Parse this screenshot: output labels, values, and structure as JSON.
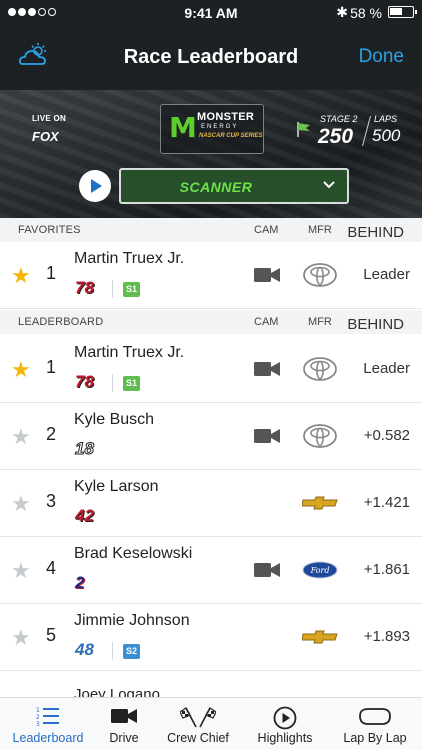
{
  "status": {
    "time": "9:41 AM",
    "battery": "58 %"
  },
  "nav": {
    "title": "Race Leaderboard",
    "done": "Done"
  },
  "hero": {
    "live_label": "LIVE ON",
    "network": "FOX",
    "logo_brand": "MONSTER",
    "logo_sub": "ENERGY",
    "logo_series": "NASCAR CUP SERIES",
    "stage_label": "STAGE 2",
    "stage_value": "250",
    "laps_label": "LAPS",
    "laps_value": "500",
    "scanner_label": "SCANNER"
  },
  "favorites_header": {
    "name": "FAVORITES",
    "cam": "CAM",
    "mfr": "MFR",
    "behind": "BEHIND"
  },
  "favorites": [
    {
      "pos": "1",
      "driver": "Martin Truex Jr.",
      "car": "78",
      "stage": "S1",
      "behind": "Leader"
    }
  ],
  "leaderboard_header": {
    "name": "LEADERBOARD",
    "cam": "CAM",
    "mfr": "MFR",
    "behind": "BEHIND"
  },
  "rows": [
    {
      "pos": "1",
      "driver": "Martin Truex Jr.",
      "car": "78",
      "stage": "S1",
      "mfr": "toyota",
      "behind": "Leader"
    },
    {
      "pos": "2",
      "driver": "Kyle Busch",
      "car": "18",
      "stage": "",
      "mfr": "toyota",
      "behind": "+0.582"
    },
    {
      "pos": "3",
      "driver": "Kyle Larson",
      "car": "42",
      "stage": "",
      "mfr": "chevrolet",
      "behind": "+1.421"
    },
    {
      "pos": "4",
      "driver": "Brad Keselowski",
      "car": "2",
      "stage": "",
      "mfr": "ford",
      "behind": "+1.861"
    },
    {
      "pos": "5",
      "driver": "Jimmie Johnson",
      "car": "48",
      "stage": "S2",
      "mfr": "chevrolet",
      "behind": "+1.893"
    }
  ],
  "peek_driver": "Joey Logano",
  "tabs": [
    {
      "label": "Leaderboard",
      "icon": "list-icon"
    },
    {
      "label": "Drive",
      "icon": "video-camera-icon"
    },
    {
      "label": "Crew Chief",
      "icon": "checkered-flags-icon"
    },
    {
      "label": "Highlights",
      "icon": "play-circle-icon"
    },
    {
      "label": "Lap By Lap",
      "icon": "track-icon"
    }
  ],
  "colors": {
    "accent": "#2a6fc4",
    "favorite": "#f2b705",
    "done": "#2aa3e6",
    "scanner_text": "#6fe04a"
  }
}
